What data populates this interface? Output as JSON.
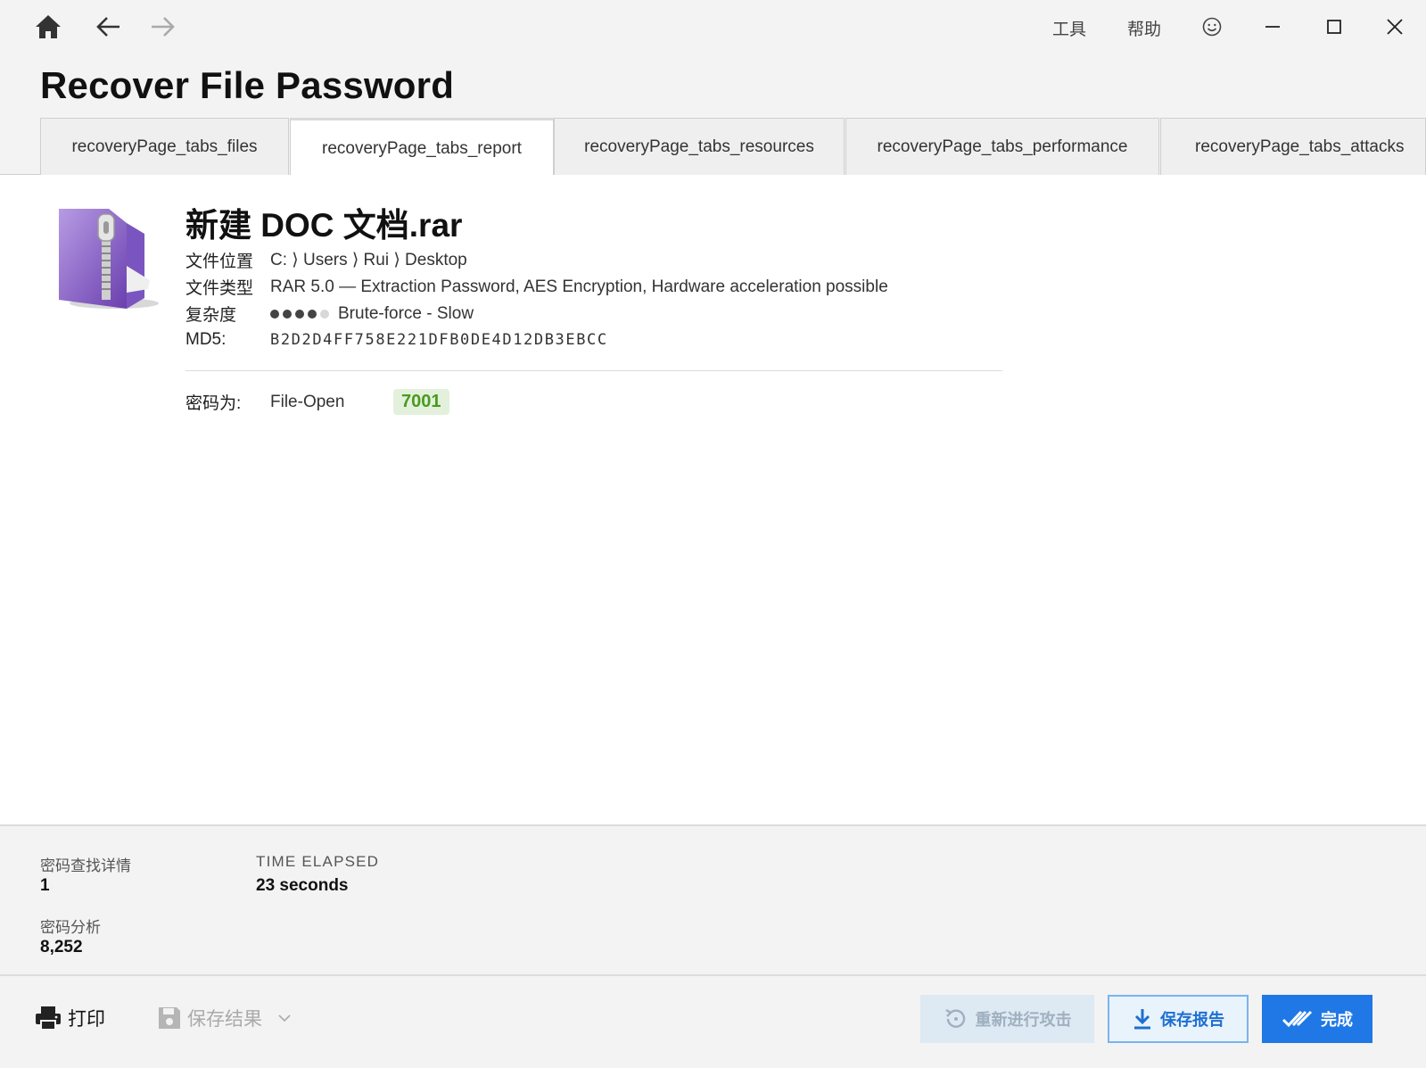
{
  "titlebar": {
    "menu_tools": "工具",
    "menu_help": "帮助",
    "icons": {
      "home": "home-icon",
      "back": "arrow-left-icon",
      "forward": "arrow-right-icon",
      "feedback": "smiley-icon",
      "minimize": "minimize-icon",
      "maximize": "maximize-icon",
      "close": "close-icon"
    }
  },
  "page": {
    "title": "Recover File Password"
  },
  "tabs": [
    {
      "label": "recoveryPage_tabs_files",
      "active": false
    },
    {
      "label": "recoveryPage_tabs_report",
      "active": true
    },
    {
      "label": "recoveryPage_tabs_resources",
      "active": false
    },
    {
      "label": "recoveryPage_tabs_performance",
      "active": false
    },
    {
      "label": "recoveryPage_tabs_attacks",
      "active": false
    }
  ],
  "report": {
    "file_name": "新建 DOC 文档.rar",
    "location_label": "文件位置",
    "location_value": "C: ⟩ Users ⟩ Rui ⟩ Desktop",
    "type_label": "文件类型",
    "type_value": "RAR 5.0 — Extraction Password, AES Encryption, Hardware acceleration possible",
    "complexity_label": "复杂度",
    "complexity_level": 4,
    "complexity_max": 5,
    "complexity_value": "Brute-force - Slow",
    "md5_label": "MD5:",
    "md5_value": "B2D2D4FF758E221DFB0DE4D12DB3EBCC",
    "password_label": "密码为:",
    "password_type": "File-Open",
    "password_value": "7001"
  },
  "stats": {
    "found_label": "密码查找详情",
    "found_value": "1",
    "elapsed_label": "TIME ELAPSED",
    "elapsed_value": "23 seconds",
    "analyzed_label": "密码分析",
    "analyzed_value": "8,252"
  },
  "bottombar": {
    "print_label": "打印",
    "save_results_label": "保存结果",
    "restart_label": "重新进行攻击",
    "save_report_label": "保存报告",
    "done_label": "完成"
  },
  "colors": {
    "accent": "#1f78e5",
    "password_badge_bg": "#e3f1dc",
    "password_badge_fg": "#4a9a1f"
  }
}
